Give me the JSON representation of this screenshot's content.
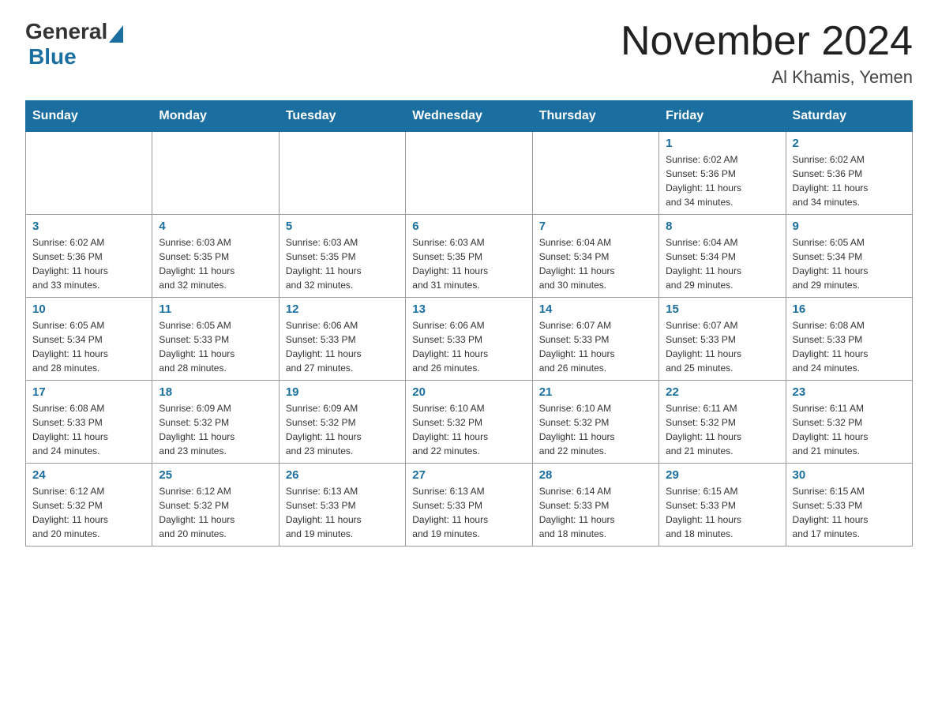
{
  "header": {
    "logo_general": "General",
    "logo_blue": "Blue",
    "month_title": "November 2024",
    "location": "Al Khamis, Yemen"
  },
  "weekdays": [
    "Sunday",
    "Monday",
    "Tuesday",
    "Wednesday",
    "Thursday",
    "Friday",
    "Saturday"
  ],
  "weeks": [
    [
      {
        "day": "",
        "info": ""
      },
      {
        "day": "",
        "info": ""
      },
      {
        "day": "",
        "info": ""
      },
      {
        "day": "",
        "info": ""
      },
      {
        "day": "",
        "info": ""
      },
      {
        "day": "1",
        "info": "Sunrise: 6:02 AM\nSunset: 5:36 PM\nDaylight: 11 hours\nand 34 minutes."
      },
      {
        "day": "2",
        "info": "Sunrise: 6:02 AM\nSunset: 5:36 PM\nDaylight: 11 hours\nand 34 minutes."
      }
    ],
    [
      {
        "day": "3",
        "info": "Sunrise: 6:02 AM\nSunset: 5:36 PM\nDaylight: 11 hours\nand 33 minutes."
      },
      {
        "day": "4",
        "info": "Sunrise: 6:03 AM\nSunset: 5:35 PM\nDaylight: 11 hours\nand 32 minutes."
      },
      {
        "day": "5",
        "info": "Sunrise: 6:03 AM\nSunset: 5:35 PM\nDaylight: 11 hours\nand 32 minutes."
      },
      {
        "day": "6",
        "info": "Sunrise: 6:03 AM\nSunset: 5:35 PM\nDaylight: 11 hours\nand 31 minutes."
      },
      {
        "day": "7",
        "info": "Sunrise: 6:04 AM\nSunset: 5:34 PM\nDaylight: 11 hours\nand 30 minutes."
      },
      {
        "day": "8",
        "info": "Sunrise: 6:04 AM\nSunset: 5:34 PM\nDaylight: 11 hours\nand 29 minutes."
      },
      {
        "day": "9",
        "info": "Sunrise: 6:05 AM\nSunset: 5:34 PM\nDaylight: 11 hours\nand 29 minutes."
      }
    ],
    [
      {
        "day": "10",
        "info": "Sunrise: 6:05 AM\nSunset: 5:34 PM\nDaylight: 11 hours\nand 28 minutes."
      },
      {
        "day": "11",
        "info": "Sunrise: 6:05 AM\nSunset: 5:33 PM\nDaylight: 11 hours\nand 28 minutes."
      },
      {
        "day": "12",
        "info": "Sunrise: 6:06 AM\nSunset: 5:33 PM\nDaylight: 11 hours\nand 27 minutes."
      },
      {
        "day": "13",
        "info": "Sunrise: 6:06 AM\nSunset: 5:33 PM\nDaylight: 11 hours\nand 26 minutes."
      },
      {
        "day": "14",
        "info": "Sunrise: 6:07 AM\nSunset: 5:33 PM\nDaylight: 11 hours\nand 26 minutes."
      },
      {
        "day": "15",
        "info": "Sunrise: 6:07 AM\nSunset: 5:33 PM\nDaylight: 11 hours\nand 25 minutes."
      },
      {
        "day": "16",
        "info": "Sunrise: 6:08 AM\nSunset: 5:33 PM\nDaylight: 11 hours\nand 24 minutes."
      }
    ],
    [
      {
        "day": "17",
        "info": "Sunrise: 6:08 AM\nSunset: 5:33 PM\nDaylight: 11 hours\nand 24 minutes."
      },
      {
        "day": "18",
        "info": "Sunrise: 6:09 AM\nSunset: 5:32 PM\nDaylight: 11 hours\nand 23 minutes."
      },
      {
        "day": "19",
        "info": "Sunrise: 6:09 AM\nSunset: 5:32 PM\nDaylight: 11 hours\nand 23 minutes."
      },
      {
        "day": "20",
        "info": "Sunrise: 6:10 AM\nSunset: 5:32 PM\nDaylight: 11 hours\nand 22 minutes."
      },
      {
        "day": "21",
        "info": "Sunrise: 6:10 AM\nSunset: 5:32 PM\nDaylight: 11 hours\nand 22 minutes."
      },
      {
        "day": "22",
        "info": "Sunrise: 6:11 AM\nSunset: 5:32 PM\nDaylight: 11 hours\nand 21 minutes."
      },
      {
        "day": "23",
        "info": "Sunrise: 6:11 AM\nSunset: 5:32 PM\nDaylight: 11 hours\nand 21 minutes."
      }
    ],
    [
      {
        "day": "24",
        "info": "Sunrise: 6:12 AM\nSunset: 5:32 PM\nDaylight: 11 hours\nand 20 minutes."
      },
      {
        "day": "25",
        "info": "Sunrise: 6:12 AM\nSunset: 5:32 PM\nDaylight: 11 hours\nand 20 minutes."
      },
      {
        "day": "26",
        "info": "Sunrise: 6:13 AM\nSunset: 5:33 PM\nDaylight: 11 hours\nand 19 minutes."
      },
      {
        "day": "27",
        "info": "Sunrise: 6:13 AM\nSunset: 5:33 PM\nDaylight: 11 hours\nand 19 minutes."
      },
      {
        "day": "28",
        "info": "Sunrise: 6:14 AM\nSunset: 5:33 PM\nDaylight: 11 hours\nand 18 minutes."
      },
      {
        "day": "29",
        "info": "Sunrise: 6:15 AM\nSunset: 5:33 PM\nDaylight: 11 hours\nand 18 minutes."
      },
      {
        "day": "30",
        "info": "Sunrise: 6:15 AM\nSunset: 5:33 PM\nDaylight: 11 hours\nand 17 minutes."
      }
    ]
  ]
}
